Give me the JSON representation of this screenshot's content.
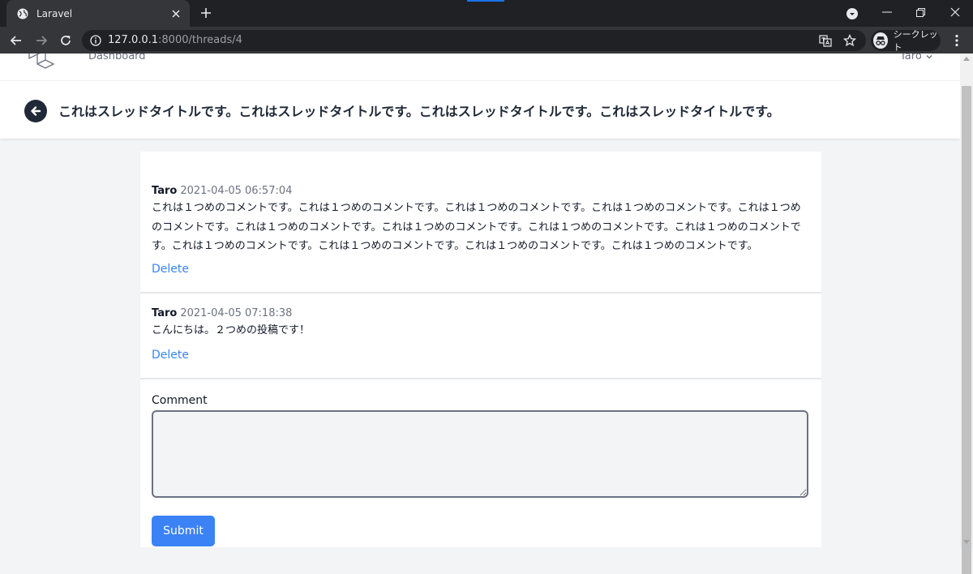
{
  "browser": {
    "tab_title": "Laravel",
    "url_host": "127.0.0.1",
    "url_rest": ":8000/threads/4",
    "incognito_label": "シークレット"
  },
  "nav": {
    "dashboard_label": "Dashboard",
    "user_name": "Taro"
  },
  "thread": {
    "title": "これはスレッドタイトルです。これはスレッドタイトルです。これはスレッドタイトルです。これはスレッドタイトルです。"
  },
  "comments": [
    {
      "author": "Taro",
      "date": "2021-04-05 06:57:04",
      "body": "これは１つめのコメントです。これは１つめのコメントです。これは１つめのコメントです。これは１つめのコメントです。これは１つめのコメントです。これは１つめのコメントです。これは１つめのコメントです。これは１つめのコメントです。これは１つめのコメントです。これは１つめのコメントです。これは１つめのコメントです。これは１つめのコメントです。これは１つめのコメントです。",
      "delete_label": "Delete"
    },
    {
      "author": "Taro",
      "date": "2021-04-05 07:18:38",
      "body": "こんにちは。２つめの投稿です！",
      "delete_label": "Delete"
    }
  ],
  "form": {
    "label": "Comment",
    "value": "",
    "submit_label": "Submit"
  },
  "colors": {
    "accent": "#3b82f6",
    "header_dark": "#1f2937",
    "background": "#f3f4f6"
  }
}
